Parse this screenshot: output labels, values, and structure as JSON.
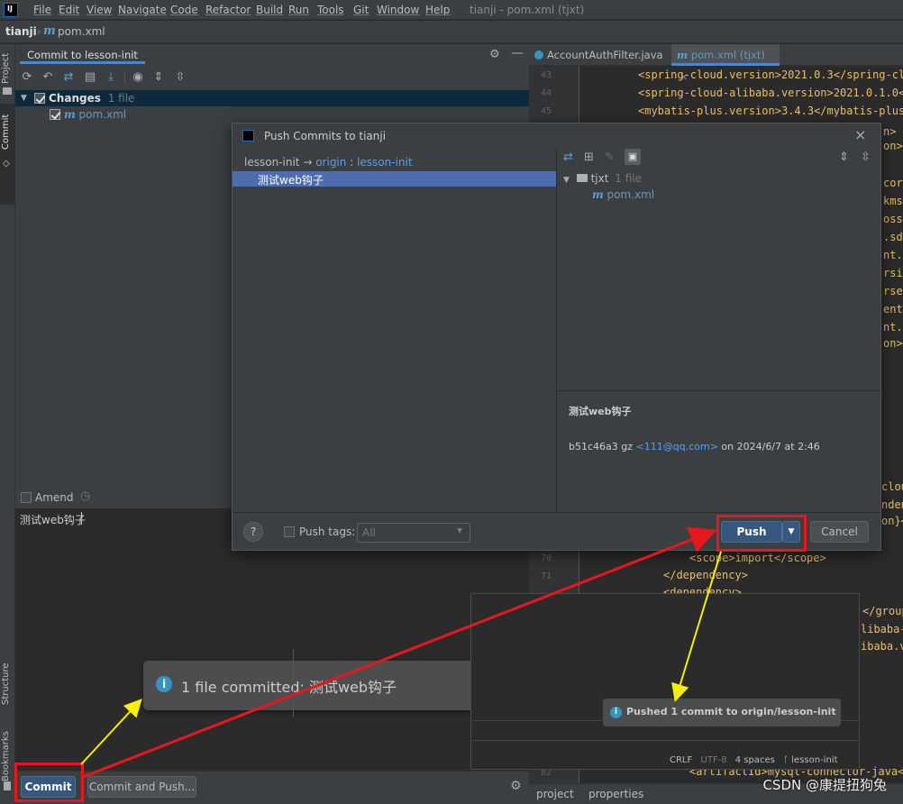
{
  "menubar": {
    "logo": "IJ",
    "items": [
      "File",
      "Edit",
      "View",
      "Navigate",
      "Code",
      "Refactor",
      "Build",
      "Run",
      "Tools",
      "Git",
      "Window",
      "Help"
    ],
    "window_title": "tianji - pom.xml (tjxt)"
  },
  "navbar": {
    "project": "tianji",
    "file": "pom.xml"
  },
  "side_tabs": {
    "project": "Project",
    "commit": "Commit",
    "structure": "Structure",
    "bookmarks": "Bookmarks"
  },
  "commit_panel": {
    "tab_title": "Commit to lesson-init",
    "changes_label": "Changes",
    "changes_count": "1 file",
    "file": "pom.xml",
    "amend_label": "Amend",
    "message": "测试web钩子",
    "commit_button": "Commit",
    "commit_push_button": "Commit and Push..."
  },
  "editor": {
    "tabs": [
      {
        "label": "AccountAuthFilter.java"
      },
      {
        "label": "pom.xml (tjxt)"
      }
    ],
    "lines": [
      {
        "n": "43",
        "code": "<spring-cloud.version>2021.0.3</spring-cl"
      },
      {
        "n": "44",
        "code": "<spring-cloud-alibaba.version>2021.0.1.0<"
      },
      {
        "n": "45",
        "code": "<mybatis-plus.version>3.4.3</mybatis-plus"
      }
    ],
    "right_fragments": [
      "n>",
      "on>",
      "core",
      "kms.",
      "oss.",
      ".sdk",
      "nt.c",
      "rsio",
      "rsea",
      "ent.",
      "nt.s",
      "on>"
    ],
    "lower_fragments": [
      "clou",
      "nden",
      "on}<"
    ],
    "line70": "70",
    "line71": "71",
    "scope_line": "<scope>import</scope>",
    "dep_close": "</dependency>",
    "dep_open": "<dependency>",
    "extra_right": [
      "</group",
      "libaba-",
      "ibaba.v"
    ],
    "line82": "82",
    "artifact_line": "<artifactId>mysql-connector-java</",
    "bottom_tabs": [
      "project",
      "properties"
    ]
  },
  "dialog": {
    "title": "Push Commits to tianji",
    "branch_from": "lesson-init",
    "arrow": "→",
    "remote": "origin",
    "sep": ":",
    "branch_to": "lesson-init",
    "commit_msg": "测试web钩子",
    "tree_root": "tjxt",
    "tree_count": "1 file",
    "tree_file": "pom.xml",
    "detail_msg": "测试web钩子",
    "detail_hash": "b51c46a3 gz",
    "detail_email": "<111@qq.com>",
    "detail_date": "on 2024/6/7 at 2:46",
    "help": "?",
    "push_tags_label": "Push tags:",
    "push_tags_value": "All",
    "push_button": "Push",
    "cancel_button": "Cancel"
  },
  "toast1": {
    "text": "1 file committed: 测试web钩子"
  },
  "panel2": {
    "toast": "Pushed 1 commit to origin/lesson-init",
    "status": [
      "CRLF",
      "UTF-8",
      "4 spaces",
      "lesson-init"
    ]
  },
  "watermark": "CSDN @康提扭狗兔",
  "colors": {
    "accent": "#4a88c7",
    "highlight": "#e8171d",
    "arrow_yellow": "#f6f000",
    "selection": "#4b6eaf"
  }
}
